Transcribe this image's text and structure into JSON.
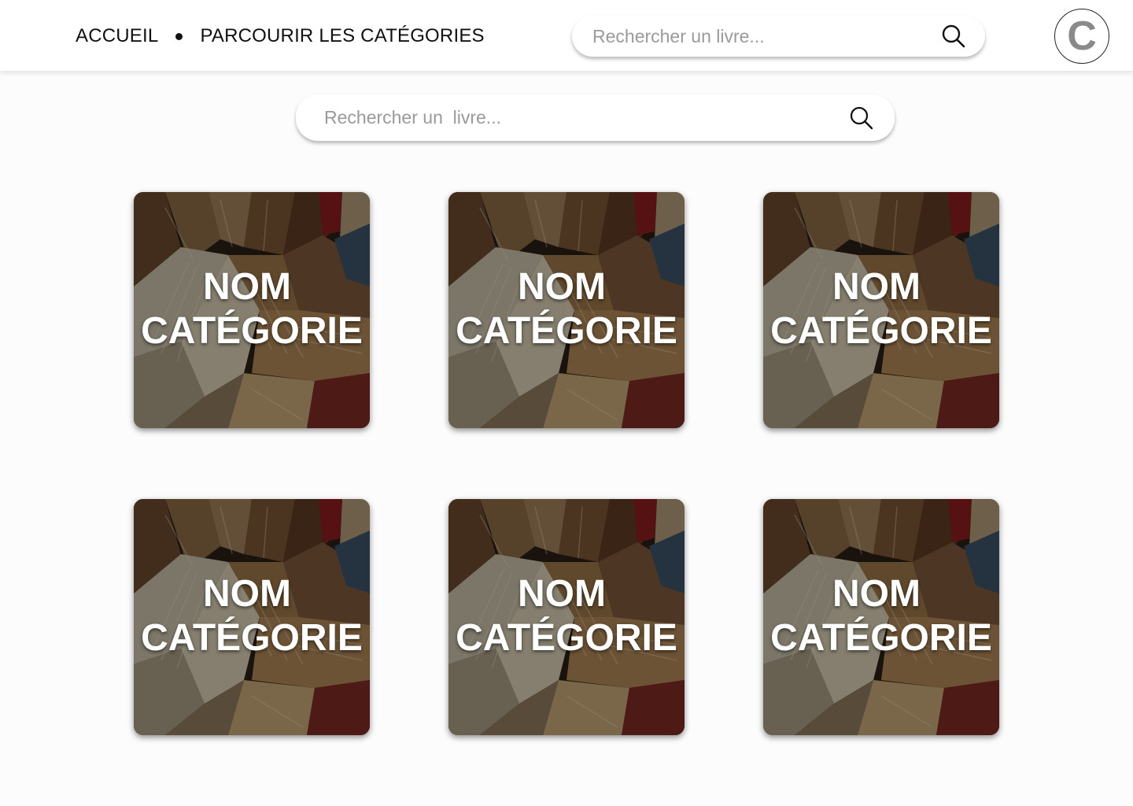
{
  "nav": {
    "home": "ACCUEIL",
    "categories": "PARCOURIR LES CATÉGORIES"
  },
  "header_search": {
    "placeholder": "Rechercher un livre...",
    "icon": "search-icon"
  },
  "main_search": {
    "placeholder": "Rechercher un  livre...",
    "icon": "search-icon"
  },
  "avatar": {
    "initial": "C"
  },
  "categories": [
    {
      "line1": "NOM",
      "line2": "CATÉGORIE"
    },
    {
      "line1": "NOM",
      "line2": "CATÉGORIE"
    },
    {
      "line1": "NOM",
      "line2": "CATÉGORIE"
    },
    {
      "line1": "NOM",
      "line2": "CATÉGORIE"
    },
    {
      "line1": "NOM",
      "line2": "CATÉGORIE"
    },
    {
      "line1": "NOM",
      "line2": "CATÉGORIE"
    }
  ],
  "colors": {
    "background": "#fcfcfc",
    "header": "#ffffff",
    "text": "#111111",
    "placeholder": "#9a9a9a",
    "avatar_letter": "#8a8a8a"
  }
}
